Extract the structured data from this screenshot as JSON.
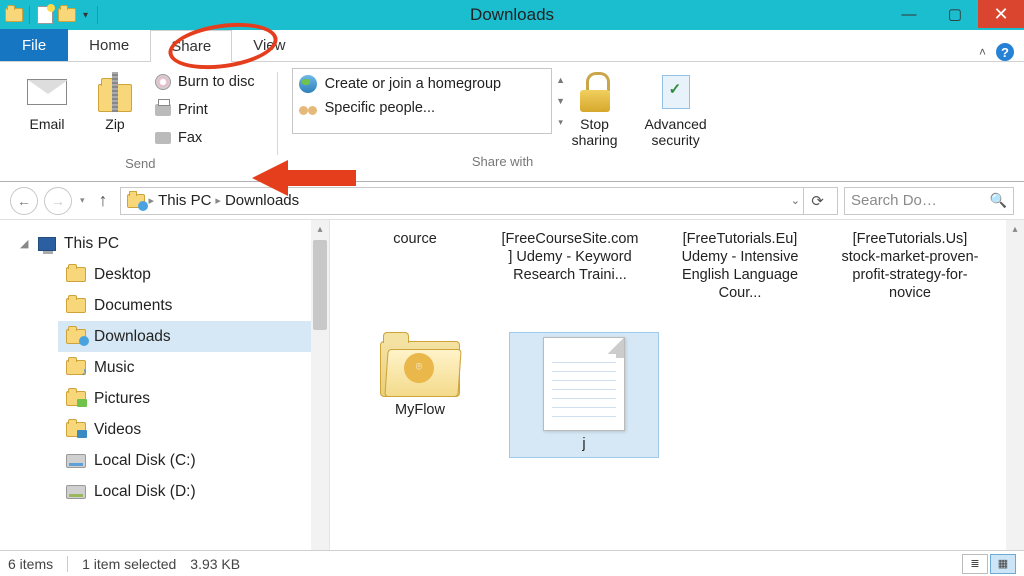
{
  "window": {
    "title": "Downloads"
  },
  "tabs": {
    "file": "File",
    "home": "Home",
    "share": "Share",
    "view": "View"
  },
  "ribbon": {
    "email": "Email",
    "zip": "Zip",
    "burn": "Burn to disc",
    "print": "Print",
    "fax": "Fax",
    "send_group": "Send",
    "homegroup": "Create or join a homegroup",
    "specific": "Specific people...",
    "sharewith_group": "Share with",
    "stop1": "Stop",
    "stop2": "sharing",
    "adv1": "Advanced",
    "adv2": "security"
  },
  "breadcrumb": {
    "pc": "This PC",
    "dl": "Downloads"
  },
  "search": {
    "placeholder": "Search Do…"
  },
  "tree": {
    "pc": "This PC",
    "desktop": "Desktop",
    "documents": "Documents",
    "downloads": "Downloads",
    "music": "Music",
    "pictures": "Pictures",
    "videos": "Videos",
    "diskc": "Local Disk (C:)",
    "diskd": "Local Disk (D:)"
  },
  "items": {
    "r1c1": "cource",
    "r1c2": "[FreeCourseSite.com] Udemy - Keyword Research Traini...",
    "r1c3": "[FreeTutorials.Eu] Udemy - Intensive English Language Cour...",
    "r1c4": "[FreeTutorials.Us] stock-market-proven-profit-strategy-for-novice",
    "r2c1": "MyFlow",
    "r2c2": "j"
  },
  "status": {
    "count": "6 items",
    "selected": "1 item selected",
    "size": "3.93 KB"
  }
}
